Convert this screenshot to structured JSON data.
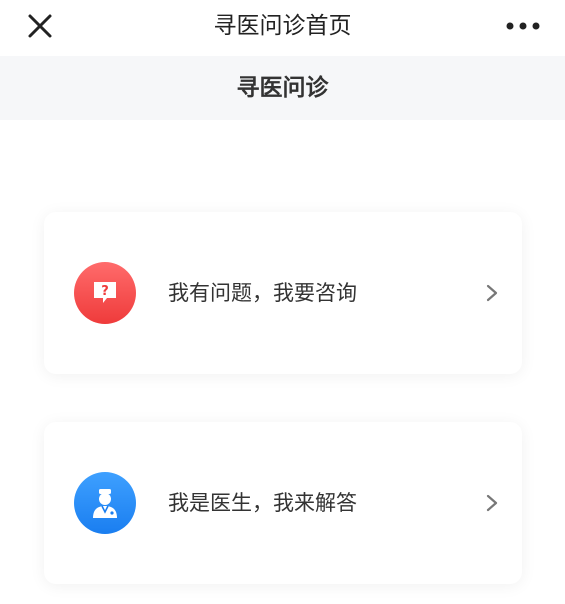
{
  "topbar": {
    "title": "寻医问诊首页",
    "close_icon": "close-icon",
    "more_icon": "more-dots-icon"
  },
  "subheader": {
    "title": "寻医问诊"
  },
  "cards": [
    {
      "label": "我有问题，我要咨询",
      "icon": "question-bubble-icon",
      "icon_color": "#ef3b3b"
    },
    {
      "label": "我是医生，我来解答",
      "icon": "doctor-icon",
      "icon_color": "#1a7ef0"
    }
  ]
}
